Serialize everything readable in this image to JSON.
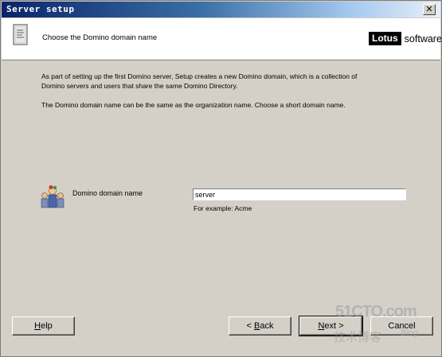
{
  "window": {
    "title": "Server setup",
    "close_glyph": "✕"
  },
  "header": {
    "title": "Choose the Domino domain name",
    "logo_brand": "Lotus",
    "logo_suffix": "software"
  },
  "content": {
    "paragraph1_line1": "As part of setting up the first Domino server, Setup creates a new Domino domain, which is a collection of",
    "paragraph1_line2": "Domino servers and users that share the same Domino Directory.",
    "paragraph2": "The Domino domain name can be the same as the organization name. Choose a short domain name."
  },
  "form": {
    "domain_label": "Domino domain name",
    "domain_value": "server",
    "example_text": "For example: Acme",
    "icon": "users-group-icon"
  },
  "buttons": {
    "help_accel": "H",
    "help_rest": "elp",
    "back_prefix": "< ",
    "back_accel": "B",
    "back_rest": "ack",
    "next_accel": "N",
    "next_rest": "ext >",
    "cancel": "Cancel"
  },
  "watermark": {
    "line1": "51CTO.com",
    "line2": "技术博客",
    "line3": "Blog"
  },
  "colors": {
    "titlebar_start": "#0a246a",
    "titlebar_end": "#a6caf0",
    "dialog_bg": "#d4d0c8",
    "header_bg": "#ffffff"
  }
}
